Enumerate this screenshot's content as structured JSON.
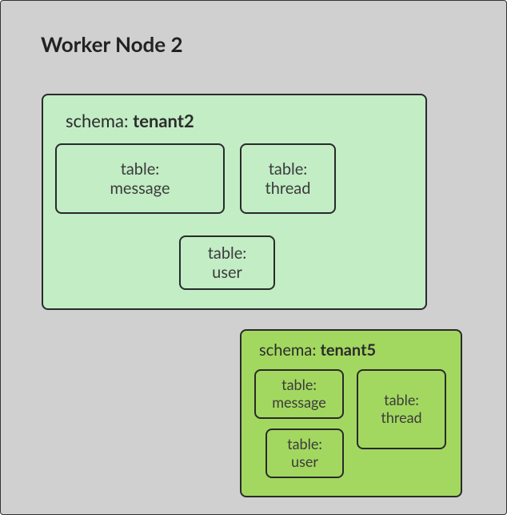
{
  "title": "Worker Node 2",
  "schemas": [
    {
      "label_prefix": "schema: ",
      "label_name": "tenant2",
      "color": "green",
      "tables": [
        {
          "line1": "table:",
          "line2": "message"
        },
        {
          "line1": "table:",
          "line2": "thread"
        },
        {
          "line1": "table:",
          "line2": "user"
        }
      ]
    },
    {
      "label_prefix": "schema: ",
      "label_name": "tenant5",
      "color": "lime",
      "tables": [
        {
          "line1": "table:",
          "line2": "message"
        },
        {
          "line1": "table:",
          "line2": "thread"
        },
        {
          "line1": "table:",
          "line2": "user"
        }
      ]
    }
  ]
}
